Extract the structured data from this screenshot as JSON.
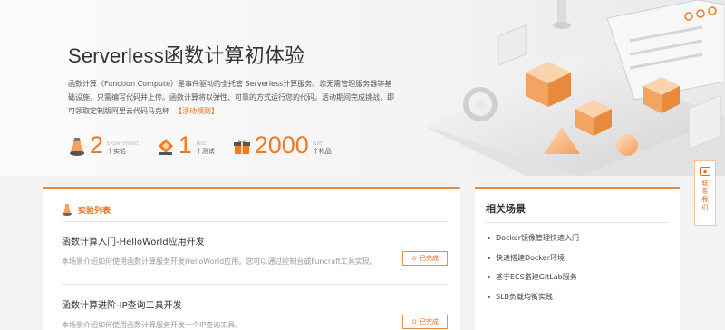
{
  "hero": {
    "title": "Serverless函数计算初体验",
    "description": "函数计算（Function Compute）是事件驱动的全托管 Serverless计算服务。您无需管理服务器等基础设施，只需编写代码并上传。函数计算将以弹性、可靠的方式运行您的代码。活动期间完成挑战，即可领取定制版阿里云代码马克杯",
    "rule_link": "【活动规则】",
    "stats": [
      {
        "number": "2",
        "en": "Experiment",
        "cn": "个实验",
        "icon": "flask-icon"
      },
      {
        "number": "1",
        "en": "Test",
        "cn": "个测试",
        "icon": "medal-icon"
      },
      {
        "number": "2000",
        "en": "Gift",
        "cn": "个礼品",
        "icon": "gift-icon"
      }
    ]
  },
  "experiments": {
    "heading": "实验列表",
    "items": [
      {
        "title": "函数计算入门-HelloWorld应用开发",
        "description": "本场景介绍如何使用函数计算服务开发HelloWorld应用。您可以通过控制台或Funcraft工具实现。",
        "status": "已完成"
      },
      {
        "title": "函数计算进阶-IP查询工具开发",
        "description": "本场景介绍如何使用函数计算服务开发一个IP查询工具。",
        "status": "已完成"
      }
    ]
  },
  "related": {
    "title": "相关场景",
    "items": [
      "Docker镜像管理快速入门",
      "快速搭建Docker环境",
      "基于ECS搭建GitLab服务",
      "SLB负载均衡实践"
    ]
  },
  "contact": {
    "label": "联系我们",
    "icon": "chat-icon"
  },
  "colors": {
    "accent": "#f07a22",
    "border": "#f08a3c"
  }
}
